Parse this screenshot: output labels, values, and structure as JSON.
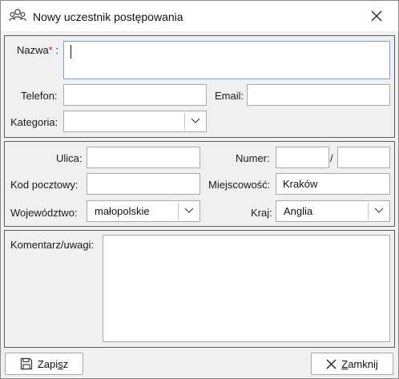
{
  "window": {
    "title": "Nowy uczestnik postępowania"
  },
  "icons": {
    "title": "users-icon",
    "close": "close-icon",
    "save": "floppy-disk-icon",
    "dropdown": "chevron-down-icon",
    "close_button": "x-icon"
  },
  "form": {
    "name_label": "Nazwa",
    "name_required_marker": "*",
    "name_colon": ":",
    "name_value": "",
    "phone_label": "Telefon:",
    "phone_value": "",
    "email_label": "Email:",
    "email_value": "",
    "category_label": "Kategoria:",
    "category_value": ""
  },
  "address": {
    "street_label": "Ulica:",
    "street_value": "",
    "number_label": "Numer:",
    "number_value": "",
    "number_separator": "/",
    "number_suffix_value": "",
    "postal_label": "Kod pocztowy:",
    "postal_value": "",
    "city_label": "Miejscowość:",
    "city_value": "Kraków",
    "province_label": "Województwo:",
    "province_value": "małopolskie",
    "country_label": "Kraj:",
    "country_value": "Anglia"
  },
  "comments": {
    "label": "Komentarz/uwagi:",
    "value": ""
  },
  "buttons": {
    "save_first": "Zapi",
    "save_mnemonic": "s",
    "save_rest": "z",
    "close_first": "",
    "close_mnemonic": "Z",
    "close_rest": "amknij"
  }
}
